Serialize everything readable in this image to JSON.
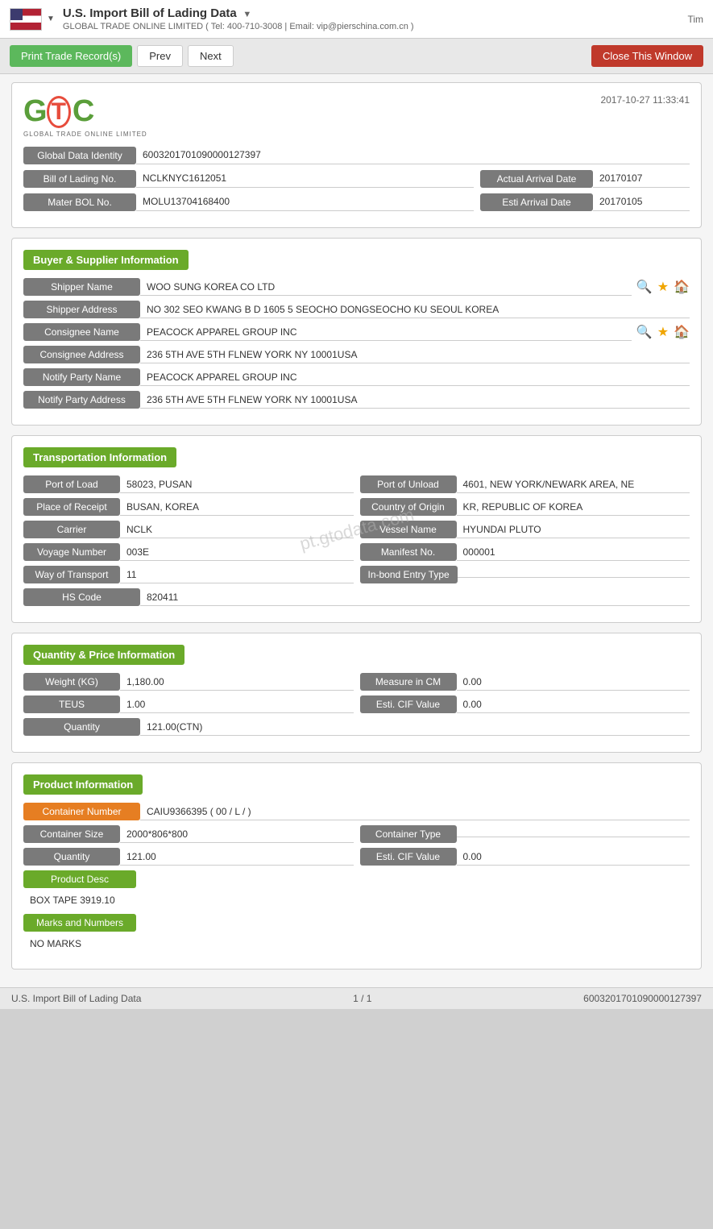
{
  "header": {
    "title": "U.S. Import Bill of Lading Data",
    "subtitle": "GLOBAL TRADE ONLINE LIMITED ( Tel: 400-710-3008 | Email: vip@pierschina.com.cn )",
    "time": "Tim"
  },
  "toolbar": {
    "print_label": "Print Trade Record(s)",
    "prev_label": "Prev",
    "next_label": "Next",
    "close_label": "Close This Window"
  },
  "logo": {
    "date": "2017-10-27 11:33:41",
    "company": "GLOBAL TRADE ONLINE LIMITED"
  },
  "identity": {
    "global_data_identity_label": "Global Data Identity",
    "global_data_identity_value": "6003201701090000127397",
    "bill_of_lading_label": "Bill of Lading No.",
    "bill_of_lading_value": "NCLKNYC1612051",
    "actual_arrival_label": "Actual Arrival Date",
    "actual_arrival_value": "20170107",
    "master_bol_label": "Mater BOL No.",
    "master_bol_value": "MOLU13704168400",
    "esti_arrival_label": "Esti Arrival Date",
    "esti_arrival_value": "20170105"
  },
  "buyer_supplier": {
    "section_label": "Buyer & Supplier Information",
    "shipper_name_label": "Shipper Name",
    "shipper_name_value": "WOO SUNG KOREA CO LTD",
    "shipper_address_label": "Shipper Address",
    "shipper_address_value": "NO 302 SEO KWANG B D 1605 5 SEOCHO DONGSEOCHO KU SEOUL KOREA",
    "consignee_name_label": "Consignee Name",
    "consignee_name_value": "PEACOCK APPAREL GROUP INC",
    "consignee_address_label": "Consignee Address",
    "consignee_address_value": "236 5TH AVE 5TH FLNEW YORK NY 10001USA",
    "notify_party_name_label": "Notify Party Name",
    "notify_party_name_value": "PEACOCK APPAREL GROUP INC",
    "notify_party_address_label": "Notify Party Address",
    "notify_party_address_value": "236 5TH AVE 5TH FLNEW YORK NY 10001USA"
  },
  "transportation": {
    "section_label": "Transportation Information",
    "port_of_load_label": "Port of Load",
    "port_of_load_value": "58023, PUSAN",
    "port_of_unload_label": "Port of Unload",
    "port_of_unload_value": "4601, NEW YORK/NEWARK AREA, NE",
    "place_of_receipt_label": "Place of Receipt",
    "place_of_receipt_value": "BUSAN, KOREA",
    "country_of_origin_label": "Country of Origin",
    "country_of_origin_value": "KR, REPUBLIC OF KOREA",
    "carrier_label": "Carrier",
    "carrier_value": "NCLK",
    "vessel_name_label": "Vessel Name",
    "vessel_name_value": "HYUNDAI PLUTO",
    "voyage_number_label": "Voyage Number",
    "voyage_number_value": "003E",
    "manifest_no_label": "Manifest No.",
    "manifest_no_value": "000001",
    "way_of_transport_label": "Way of Transport",
    "way_of_transport_value": "11",
    "inbond_entry_label": "In-bond Entry Type",
    "inbond_entry_value": "",
    "hs_code_label": "HS Code",
    "hs_code_value": "820411"
  },
  "quantity_price": {
    "section_label": "Quantity & Price Information",
    "weight_label": "Weight (KG)",
    "weight_value": "1,180.00",
    "measure_label": "Measure in CM",
    "measure_value": "0.00",
    "teus_label": "TEUS",
    "teus_value": "1.00",
    "esti_cif_label": "Esti. CIF Value",
    "esti_cif_value": "0.00",
    "quantity_label": "Quantity",
    "quantity_value": "121.00(CTN)"
  },
  "product": {
    "section_label": "Product Information",
    "container_number_label": "Container Number",
    "container_number_value": "CAIU9366395 ( 00 / L / )",
    "container_size_label": "Container Size",
    "container_size_value": "2000*806*800",
    "container_type_label": "Container Type",
    "container_type_value": "",
    "quantity_label": "Quantity",
    "quantity_value": "121.00",
    "esti_cif_label": "Esti. CIF Value",
    "esti_cif_value": "0.00",
    "product_desc_label": "Product Desc",
    "product_desc_value": "BOX TAPE 3919.10",
    "marks_numbers_label": "Marks and Numbers",
    "marks_numbers_value": "NO MARKS"
  },
  "footer": {
    "left": "U.S. Import Bill of Lading Data",
    "center": "1 / 1",
    "right": "6003201701090000127397"
  },
  "watermark": "pt.gtodata.com"
}
